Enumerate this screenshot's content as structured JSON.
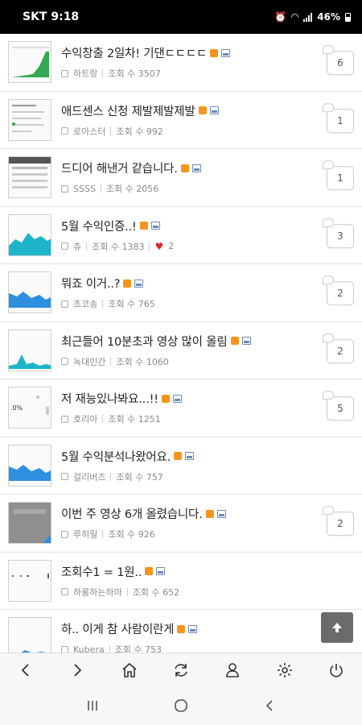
{
  "status": {
    "carrier_time": "SKT 9:18",
    "battery": "46%"
  },
  "posts": [
    {
      "title": "수익창출 2일차! 기댄ㄷㄷㄷㄷ",
      "author": "하트랑",
      "views": "조회 수 3507",
      "comments": "6",
      "likes": ""
    },
    {
      "title": "애드센스 신청 제발제발제발",
      "author": "로아스터",
      "views": "조회 수 992",
      "comments": "1",
      "likes": ""
    },
    {
      "title": "드디어 해낸거 같습니다.",
      "author": "SSSS",
      "views": "조회 수 2056",
      "comments": "1",
      "likes": ""
    },
    {
      "title": "5월 수익인증..!",
      "author": "츄",
      "views": "조회 수 1383",
      "comments": "3",
      "likes": "2"
    },
    {
      "title": "뭐죠 이거..?",
      "author": "초코송",
      "views": "조회 수 765",
      "comments": "2",
      "likes": ""
    },
    {
      "title": "최근들어 10분초과 영상 많이 올림",
      "author": "녹대인간",
      "views": "조회 수 1060",
      "comments": "2",
      "likes": ""
    },
    {
      "title": "저 재능있나봐요...!!",
      "author": "호리아",
      "views": "조회 수 1251",
      "comments": "5",
      "likes": ""
    },
    {
      "title": "5월 수익분석나왔어요.",
      "author": "걸리버즈",
      "views": "조회 수 757",
      "comments": "",
      "likes": ""
    },
    {
      "title": "이번 주 영상 6개 올렸습니다.",
      "author": "루히릴",
      "views": "조회 수 926",
      "comments": "2",
      "likes": ""
    },
    {
      "title": "조회수1 = 1원..",
      "author": "하롱하는하마",
      "views": "조회 수 652",
      "comments": "",
      "likes": ""
    },
    {
      "title": "하.. 이게 참 사람이란게",
      "author": "Kubera",
      "views": "조회 수 753",
      "comments": "",
      "likes": ""
    }
  ],
  "thumbs": [
    "green-chart",
    "list-chart",
    "dark-table",
    "teal-chart",
    "blue-chart",
    "teal-line",
    "percent-table",
    "blue-chart",
    "gray-photo",
    "dots-chart",
    "blue-small"
  ],
  "icons": {
    "scroll_top": "arrow-up-icon",
    "nav": [
      "back-icon",
      "forward-icon",
      "home-icon",
      "refresh-icon",
      "profile-icon",
      "settings-icon",
      "power-icon"
    ],
    "system": [
      "recent-apps-icon",
      "home-circle-icon",
      "system-back-icon"
    ]
  },
  "colors": {
    "badge_new": "#f7941d",
    "heart": "#e0242b",
    "chart_blue": "#2e8fe0",
    "chart_teal": "#1fb5c9"
  }
}
